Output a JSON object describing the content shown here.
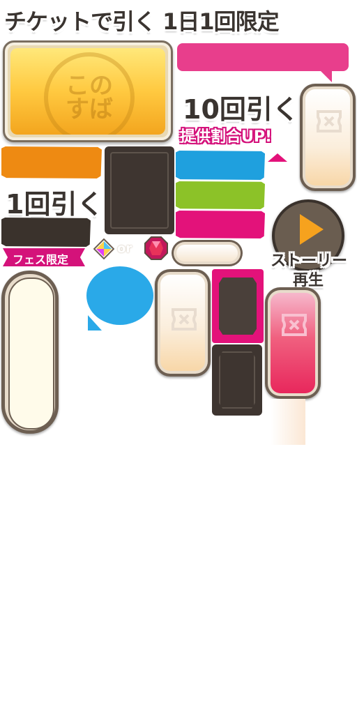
{
  "texts": {
    "ticket_daily": "チケットで引く 1日1回限定",
    "draw_10": "10回引く",
    "rate_up": "提供割合UP!",
    "draw_1": "1回引く",
    "fes_limited": "フェス限定",
    "or": "or",
    "story_play_line1": "ストーリー",
    "story_play_line2": "再生",
    "seal_text": "このすば"
  },
  "colors": {
    "gold_top": "#ffe87a",
    "gold_bottom": "#f3a51e",
    "orange_bar": "#ee8a12",
    "dark_bar": "#3a322c",
    "blue_bar": "#1fa0de",
    "green_bar": "#8cc228",
    "magenta_bar": "#e3127a",
    "pink_banner": "#e83e8c",
    "speech_blue": "#2aa9e8",
    "play_orange": "#f6a21e"
  },
  "icons": [
    "diamond-gem-icon",
    "red-gem-icon",
    "play-icon",
    "speech-bubble-icon",
    "ticket-logo-icon"
  ]
}
